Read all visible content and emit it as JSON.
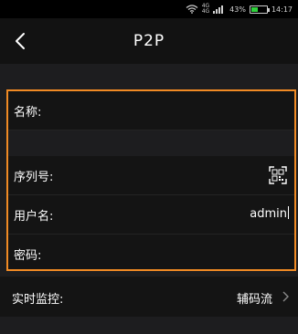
{
  "status_bar": {
    "signal_label_top": "4G",
    "signal_label_bottom": "4G",
    "battery_percent": "43%",
    "battery_level": 0.43,
    "time": "14:17"
  },
  "nav": {
    "title": "P2P",
    "back_icon": "chevron-left-icon"
  },
  "form": {
    "name_label": "名称:",
    "name_value": "",
    "serial_label": "序列号:",
    "serial_value": "",
    "qr_icon": "qr-scan-icon",
    "username_label": "用户名:",
    "username_value": "admin",
    "password_label": "密码:",
    "password_value": ""
  },
  "monitor": {
    "label": "实时监控:",
    "value": "辅码流",
    "chevron_icon": "chevron-right-icon"
  },
  "colors": {
    "highlight_border": "#f08a24",
    "battery_fill": "#2fd13c"
  }
}
